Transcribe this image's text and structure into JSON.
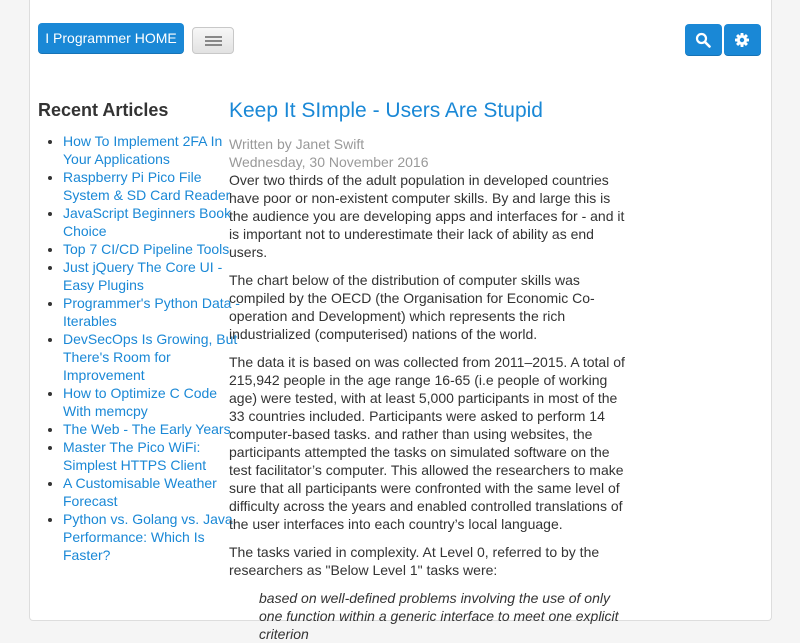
{
  "header": {
    "home_label": "I Programmer HOME"
  },
  "sidebar": {
    "title": "Recent Articles",
    "items": [
      {
        "label": "How To Implement 2FA In Your Applications"
      },
      {
        "label": "Raspberry Pi Pico File System & SD Card Reader"
      },
      {
        "label": "JavaScript Beginners Book Choice"
      },
      {
        "label": "Top 7 CI/CD Pipeline Tools"
      },
      {
        "label": "Just jQuery The Core UI - Easy Plugins"
      },
      {
        "label": "Programmer's Python Data - Iterables"
      },
      {
        "label": "DevSecOps Is Growing, But There's Room for Improvement"
      },
      {
        "label": "How to Optimize C Code With memcpy"
      },
      {
        "label": "The Web - The Early Years"
      },
      {
        "label": "Master The Pico WiFi: Simplest HTTPS Client"
      },
      {
        "label": "A Customisable Weather Forecast"
      },
      {
        "label": "Python vs. Golang vs. Java Performance: Which Is Faster?"
      }
    ]
  },
  "article": {
    "title": "Keep It SImple - Users Are Stupid",
    "author": "Written by Janet Swift",
    "date": "Wednesday, 30 November 2016",
    "paragraphs": [
      "Over two thirds of the adult population in developed countries have poor or non-existent computer skills. By and large this is the audience you are developing apps and interfaces for - and it is important not to underestimate their lack of ability as end users.",
      "The chart below of the distribution of computer skills was compiled by the OECD (the Organisation for Economic Co-operation and Development) which represents the rich industrialized (computerised) nations of the world.",
      "The data it is based on was collected from 2011–2015. A total of 215,942 people in the age range 16-65 (i.e people of working age) were tested, with at least 5,000 participants in most of the 33 countries included. Participants were asked to perform 14 computer-based tasks. and rather than using websites, the participants attempted the tasks on simulated software on the test facilitator’s computer. This allowed the researchers to make sure that all participants were confronted with the same level of difficulty across the years and enabled controlled translations of the user interfaces into each country’s local language.",
      "The tasks varied in complexity. At Level 0, referred to by the researchers as \"Below Level 1\" tasks were:"
    ],
    "quote": "based on well-defined problems involving the use of only one function within a generic interface to meet one explicit criterion"
  }
}
